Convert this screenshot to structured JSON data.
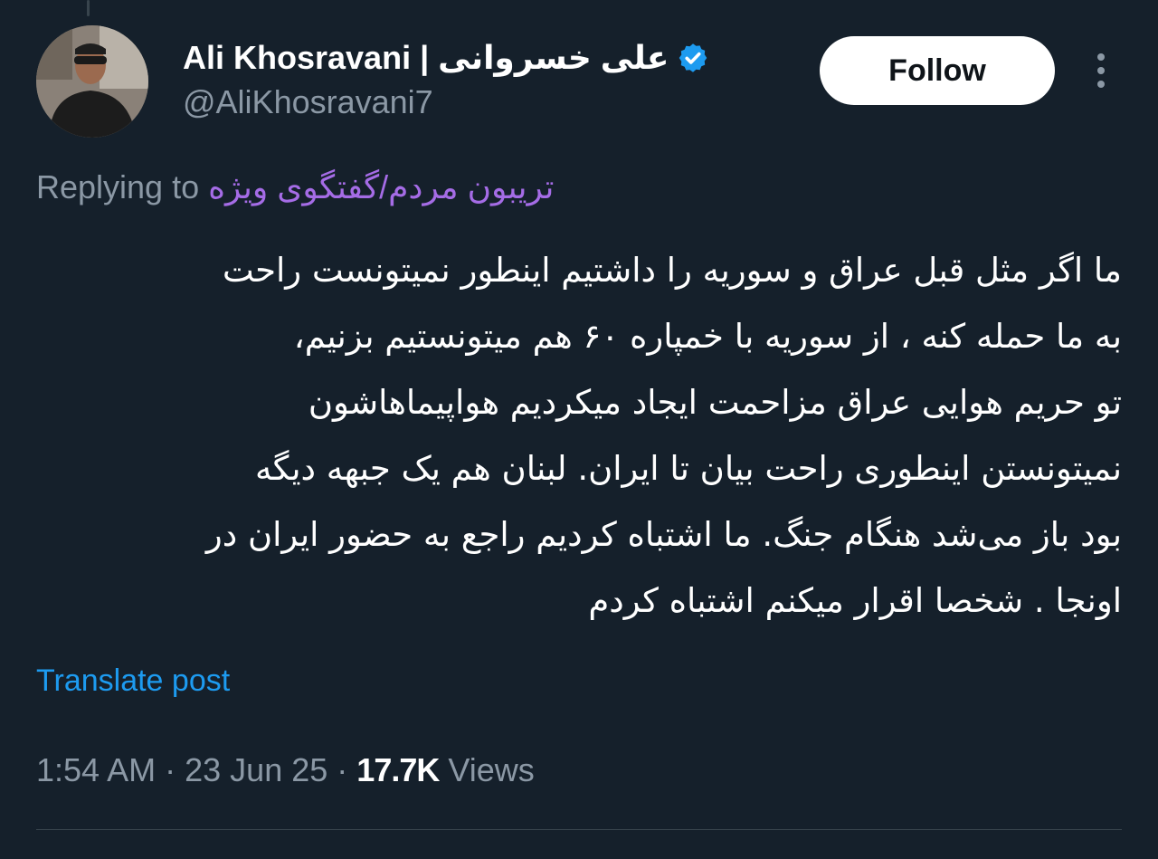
{
  "post": {
    "author": {
      "display_name": "Ali Khosravani | علی خسروانی",
      "handle": "@AliKhosravani7",
      "verified": true,
      "avatar_icon": "profile-photo"
    },
    "follow_label": "Follow",
    "more_icon": "more-vertical-icon",
    "replying_prefix": "Replying to",
    "replying_mention": "تریبون مردم/گفتگوی ویژه",
    "text_lines": [
      "ما اگر مثل قبل عراق و سوریه را داشتیم اینطور نمیتونست راحت",
      "به ما حمله کنه ، از سوریه با خمپاره ۶۰ هم میتونستیم بزنیم،",
      "تو حریم هوایی عراق مزاحمت ایجاد میکردیم هواپیماهاشون",
      "نمیتونستن اینطوری راحت بیان تا ایران. لبنان هم یک جبهه دیگه",
      "بود باز می‌شد هنگام جنگ. ما اشتباه کردیم راجع به حضور ایران در",
      "اونجا . شخصا اقرار میکنم اشتباه کردم"
    ],
    "translate_label": "Translate post",
    "time": "1:54 AM",
    "separator": "·",
    "date": "23 Jun 25",
    "views_count": "17.7K",
    "views_label": "Views"
  },
  "colors": {
    "background": "#15202b",
    "accent_blue": "#1d9bf0",
    "mention_purple": "#a56ce6",
    "secondary_text": "#8b98a5",
    "divider": "#38444d"
  }
}
